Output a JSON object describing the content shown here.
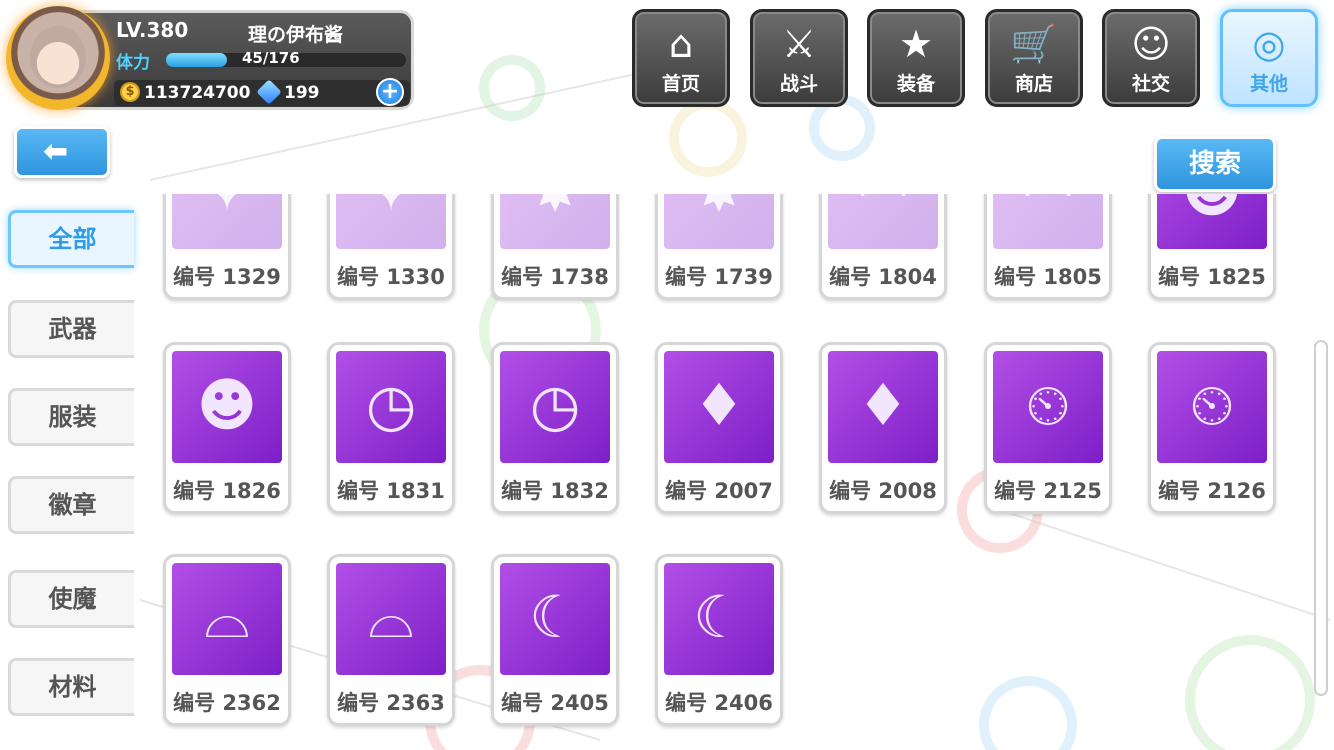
{
  "player": {
    "level": "LV.380",
    "name": "理の伊布酱",
    "stamina_label": "体力",
    "stamina": "45/176",
    "stamina_fraction": 0.256,
    "coin_symbol": "$",
    "coins": "113724700",
    "gems": "199",
    "plus_symbol": "+"
  },
  "nav": [
    {
      "label": "首页",
      "icon": "house-icon",
      "glyph": "⌂"
    },
    {
      "label": "战斗",
      "icon": "swords-icon",
      "glyph": "⚔"
    },
    {
      "label": "装备",
      "icon": "star-gun-icon",
      "glyph": "★"
    },
    {
      "label": "商店",
      "icon": "cart-icon",
      "glyph": "🛒"
    },
    {
      "label": "社交",
      "icon": "face-icon",
      "glyph": "☺"
    },
    {
      "label": "其他",
      "icon": "gear-icon",
      "glyph": "◎"
    }
  ],
  "back_glyph": "⬅",
  "search_label": "搜索",
  "tabs": [
    "全部",
    "武器",
    "服装",
    "徽章",
    "使魔",
    "材料"
  ],
  "items": [
    {
      "label": "编号 1329",
      "icon": "weapon-icon",
      "glyph": "✦"
    },
    {
      "label": "编号 1330",
      "icon": "weapon-icon",
      "glyph": "✦"
    },
    {
      "label": "编号 1738",
      "icon": "badge-icon",
      "glyph": "✸"
    },
    {
      "label": "编号 1739",
      "icon": "badge-icon",
      "glyph": "✸"
    },
    {
      "label": "编号 1804",
      "icon": "hat-icon",
      "glyph": "◠"
    },
    {
      "label": "编号 1805",
      "icon": "hat-icon",
      "glyph": "◠"
    },
    {
      "label": "编号 1825",
      "icon": "character-icon",
      "glyph": "☻"
    },
    {
      "label": "编号 1826",
      "icon": "character-icon",
      "glyph": "☻"
    },
    {
      "label": "编号 1831",
      "icon": "pocket-watch-icon",
      "glyph": "◷"
    },
    {
      "label": "编号 1832",
      "icon": "pocket-watch-icon",
      "glyph": "◷"
    },
    {
      "label": "编号 2007",
      "icon": "crystal-icon",
      "glyph": "♦"
    },
    {
      "label": "编号 2008",
      "icon": "crystal-icon",
      "glyph": "♦"
    },
    {
      "label": "编号 2125",
      "icon": "clock-staff-icon",
      "glyph": "⏲"
    },
    {
      "label": "编号 2126",
      "icon": "clock-staff-icon",
      "glyph": "⏲"
    },
    {
      "label": "编号 2362",
      "icon": "pot-lid-icon",
      "glyph": "⌓"
    },
    {
      "label": "编号 2363",
      "icon": "pot-lid-icon",
      "glyph": "⌓"
    },
    {
      "label": "编号 2405",
      "icon": "witch-icon",
      "glyph": "☾"
    },
    {
      "label": "编号 2406",
      "icon": "witch-icon",
      "glyph": "☾"
    }
  ],
  "colors": {
    "accent": "#2f9ce8",
    "item_bg": "#9a36d8"
  }
}
